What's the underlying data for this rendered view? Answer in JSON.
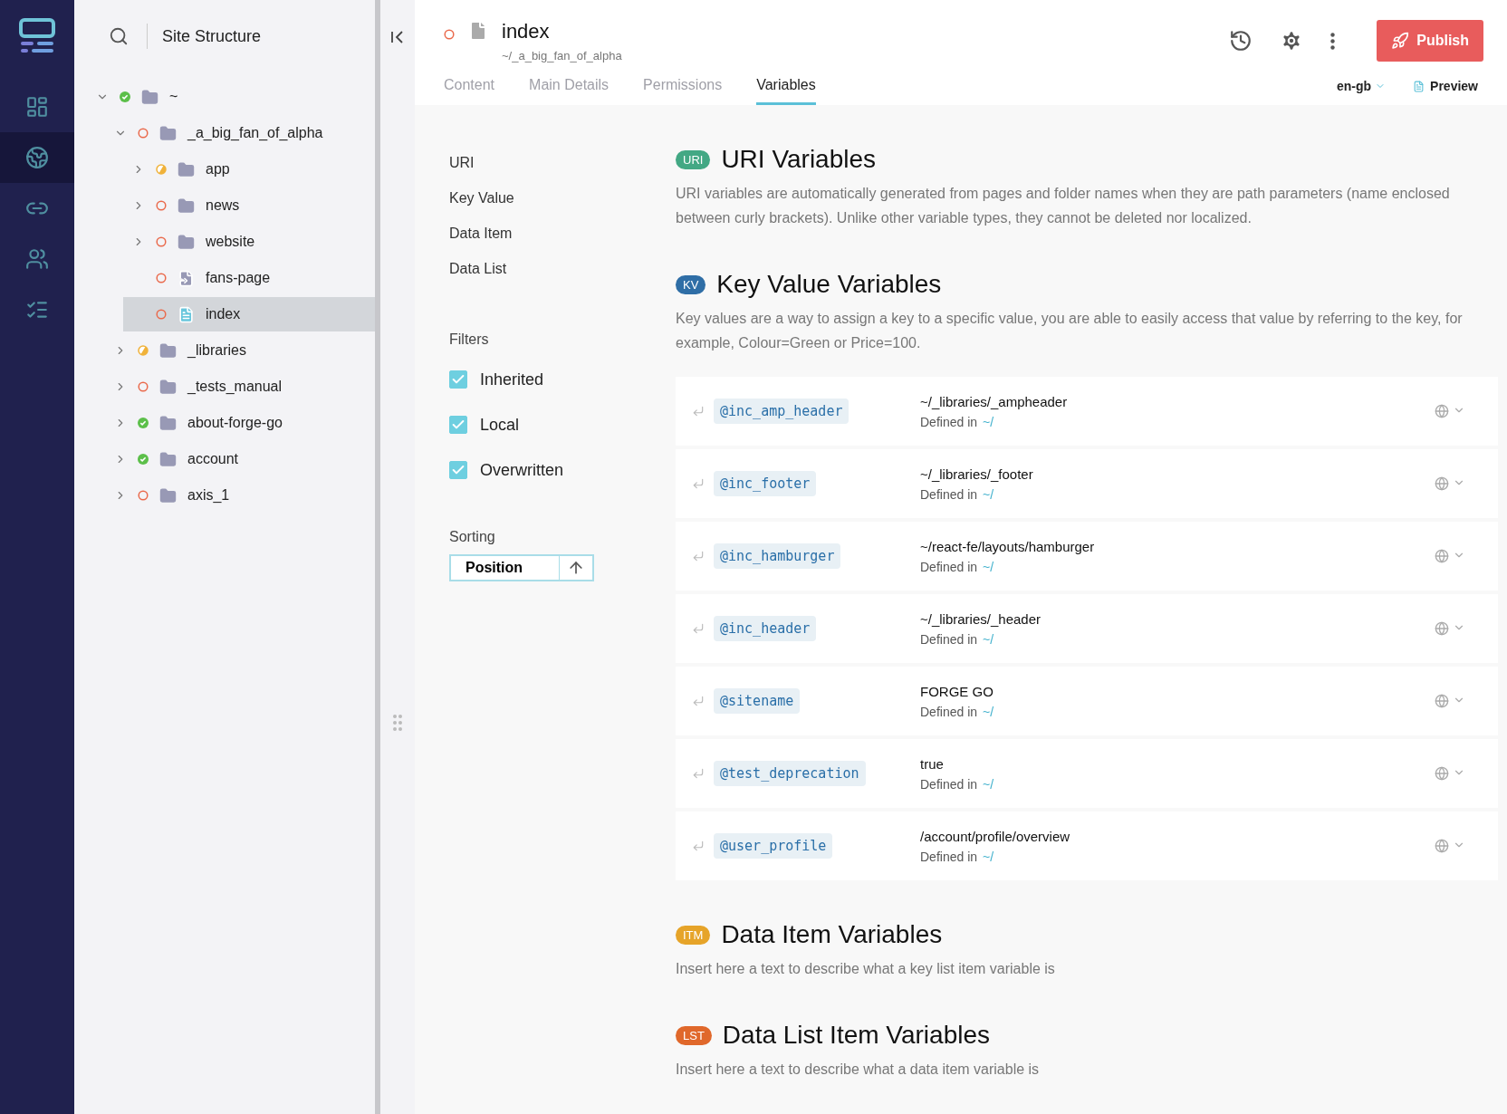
{
  "nav": {
    "items": [
      {
        "kind": "dashboard",
        "selected": false
      },
      {
        "kind": "globe",
        "selected": true
      },
      {
        "kind": "link",
        "selected": false
      },
      {
        "kind": "users",
        "selected": false
      },
      {
        "kind": "list",
        "selected": false
      }
    ]
  },
  "tree": {
    "title": "Site Structure",
    "nodes": [
      {
        "label": "~",
        "kind": "folder",
        "color": "#5cbf4a",
        "expanded": true,
        "selected": false,
        "children": [
          {
            "label": "_a_big_fan_of_alpha",
            "kind": "folder",
            "color": "#ea6a4c",
            "expanded": true,
            "selected": false,
            "children": [
              {
                "label": "app",
                "kind": "folder",
                "color": "#f0b23a",
                "expanded": false,
                "selected": false
              },
              {
                "label": "news",
                "kind": "folder",
                "color": "#ea6a4c",
                "expanded": false,
                "selected": false
              },
              {
                "label": "website",
                "kind": "folder",
                "color": "#ea6a4c",
                "expanded": false,
                "selected": false
              },
              {
                "label": "fans-page",
                "kind": "redirect",
                "color": "#ea6a4c",
                "selected": false
              },
              {
                "label": "index",
                "kind": "page",
                "color": "#ea6a4c",
                "selected": true
              }
            ]
          },
          {
            "label": "_libraries",
            "kind": "folder",
            "color": "#f0b23a",
            "expanded": false,
            "selected": false
          },
          {
            "label": "_tests_manual",
            "kind": "folder",
            "color": "#ea6a4c",
            "expanded": false,
            "selected": false
          },
          {
            "label": "about-forge-go",
            "kind": "folder",
            "color": "#5cbf4a",
            "expanded": false,
            "selected": false
          },
          {
            "label": "account",
            "kind": "folder",
            "color": "#5cbf4a",
            "expanded": false,
            "selected": false
          },
          {
            "label": "axis_1",
            "kind": "folder",
            "color": "#ea6a4c",
            "expanded": false,
            "selected": false
          }
        ]
      }
    ]
  },
  "page": {
    "status": {
      "color": "#ea6a4c"
    },
    "title": "index",
    "path": "~/_a_big_fan_of_alpha",
    "publish": "Publish",
    "locale": "en-gb",
    "preview": "Preview",
    "tabs": [
      {
        "label": "Content",
        "selected": false
      },
      {
        "label": "Main Details",
        "selected": false
      },
      {
        "label": "Permissions",
        "selected": false
      },
      {
        "label": "Variables",
        "selected": true
      }
    ]
  },
  "sidebar": {
    "anchors": [
      "URI",
      "Key Value",
      "Data Item",
      "Data List"
    ],
    "filters_title": "Filters",
    "filters": [
      {
        "label": "Inherited",
        "checked": true
      },
      {
        "label": "Local",
        "checked": true
      },
      {
        "label": "Overwritten",
        "checked": true
      }
    ],
    "sorting_title": "Sorting",
    "sorting_value": "Position"
  },
  "sections": [
    {
      "badge": "URI",
      "color": "#43a884",
      "title": "URI Variables",
      "description": "URI variables are automatically generated from pages and folder names when they are path parameters (name enclosed between curly brackets). Unlike other variable types, they cannot be deleted nor localized."
    },
    {
      "badge": "KV",
      "color": "#2f6ea6",
      "title": "Key Value Variables",
      "description": "Key values are a way to assign a key to a specific value, you are able to easily access that value by referring to the key, for example, Colour=Green or Price=100.",
      "variables": [
        {
          "name": "@inc_amp_header",
          "value": "~/_libraries/_ampheader",
          "defined_label": "Defined in",
          "defined_path": "~/"
        },
        {
          "name": "@inc_footer",
          "value": "~/_libraries/_footer",
          "defined_label": "Defined in",
          "defined_path": "~/"
        },
        {
          "name": "@inc_hamburger",
          "value": "~/react-fe/layouts/hamburger",
          "defined_label": "Defined in",
          "defined_path": "~/"
        },
        {
          "name": "@inc_header",
          "value": "~/_libraries/_header",
          "defined_label": "Defined in",
          "defined_path": "~/"
        },
        {
          "name": "@sitename",
          "value": "FORGE GO",
          "defined_label": "Defined in",
          "defined_path": "~/"
        },
        {
          "name": "@test_deprecation",
          "value": "true",
          "defined_label": "Defined in",
          "defined_path": "~/"
        },
        {
          "name": "@user_profile",
          "value": "/account/profile/overview",
          "defined_label": "Defined in",
          "defined_path": "~/"
        }
      ]
    },
    {
      "badge": "ITM",
      "color": "#e6a429",
      "title": "Data Item Variables",
      "description": "Insert here a text to describe what a key list item variable is"
    },
    {
      "badge": "LST",
      "color": "#e0682b",
      "title": "Data List Item Variables",
      "description": "Insert here a text to describe what a data item variable is"
    }
  ]
}
